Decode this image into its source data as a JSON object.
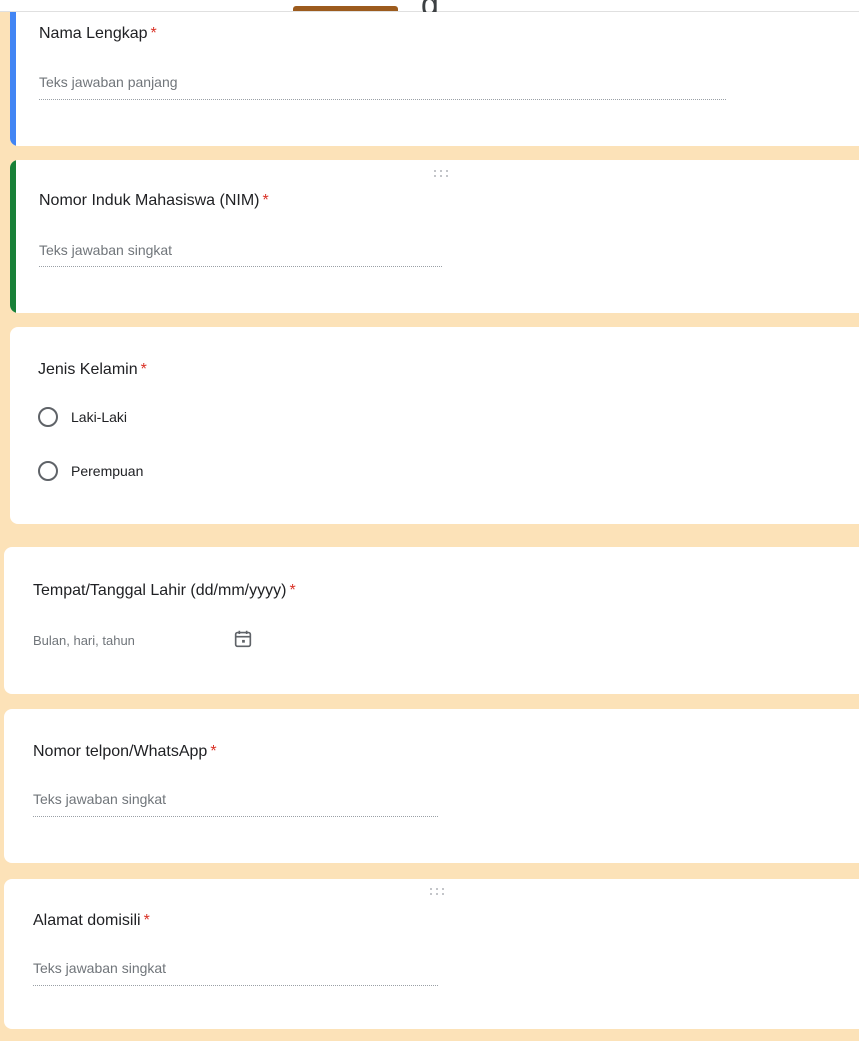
{
  "header": {
    "partial_title_glyph": "g"
  },
  "questions": [
    {
      "title": "Nama Lengkap",
      "required": "*",
      "placeholder": "Teks jawaban panjang"
    },
    {
      "title": "Nomor Induk Mahasiswa (NIM)",
      "required": "*",
      "placeholder": "Teks jawaban singkat"
    },
    {
      "title": "Jenis Kelamin",
      "required": "*",
      "options": [
        "Laki-Laki",
        "Perempuan"
      ]
    },
    {
      "title": "Tempat/Tanggal Lahir (dd/mm/yyyy)",
      "required": "*",
      "placeholder": "Bulan, hari, tahun"
    },
    {
      "title": "Nomor telpon/WhatsApp",
      "required": "*",
      "placeholder": "Teks jawaban singkat"
    },
    {
      "title": "Alamat domisili",
      "required": "*",
      "placeholder": "Teks jawaban singkat"
    }
  ],
  "colors": {
    "background": "#fce2b8",
    "accent_blue": "#4285f4",
    "accent_green": "#188038",
    "required": "#d93025",
    "tab_indicator": "#9c5b1d"
  },
  "icons": {
    "drag_handle": "drag-handle-icon",
    "calendar": "calendar-icon",
    "radio": "radio-button-icon"
  }
}
